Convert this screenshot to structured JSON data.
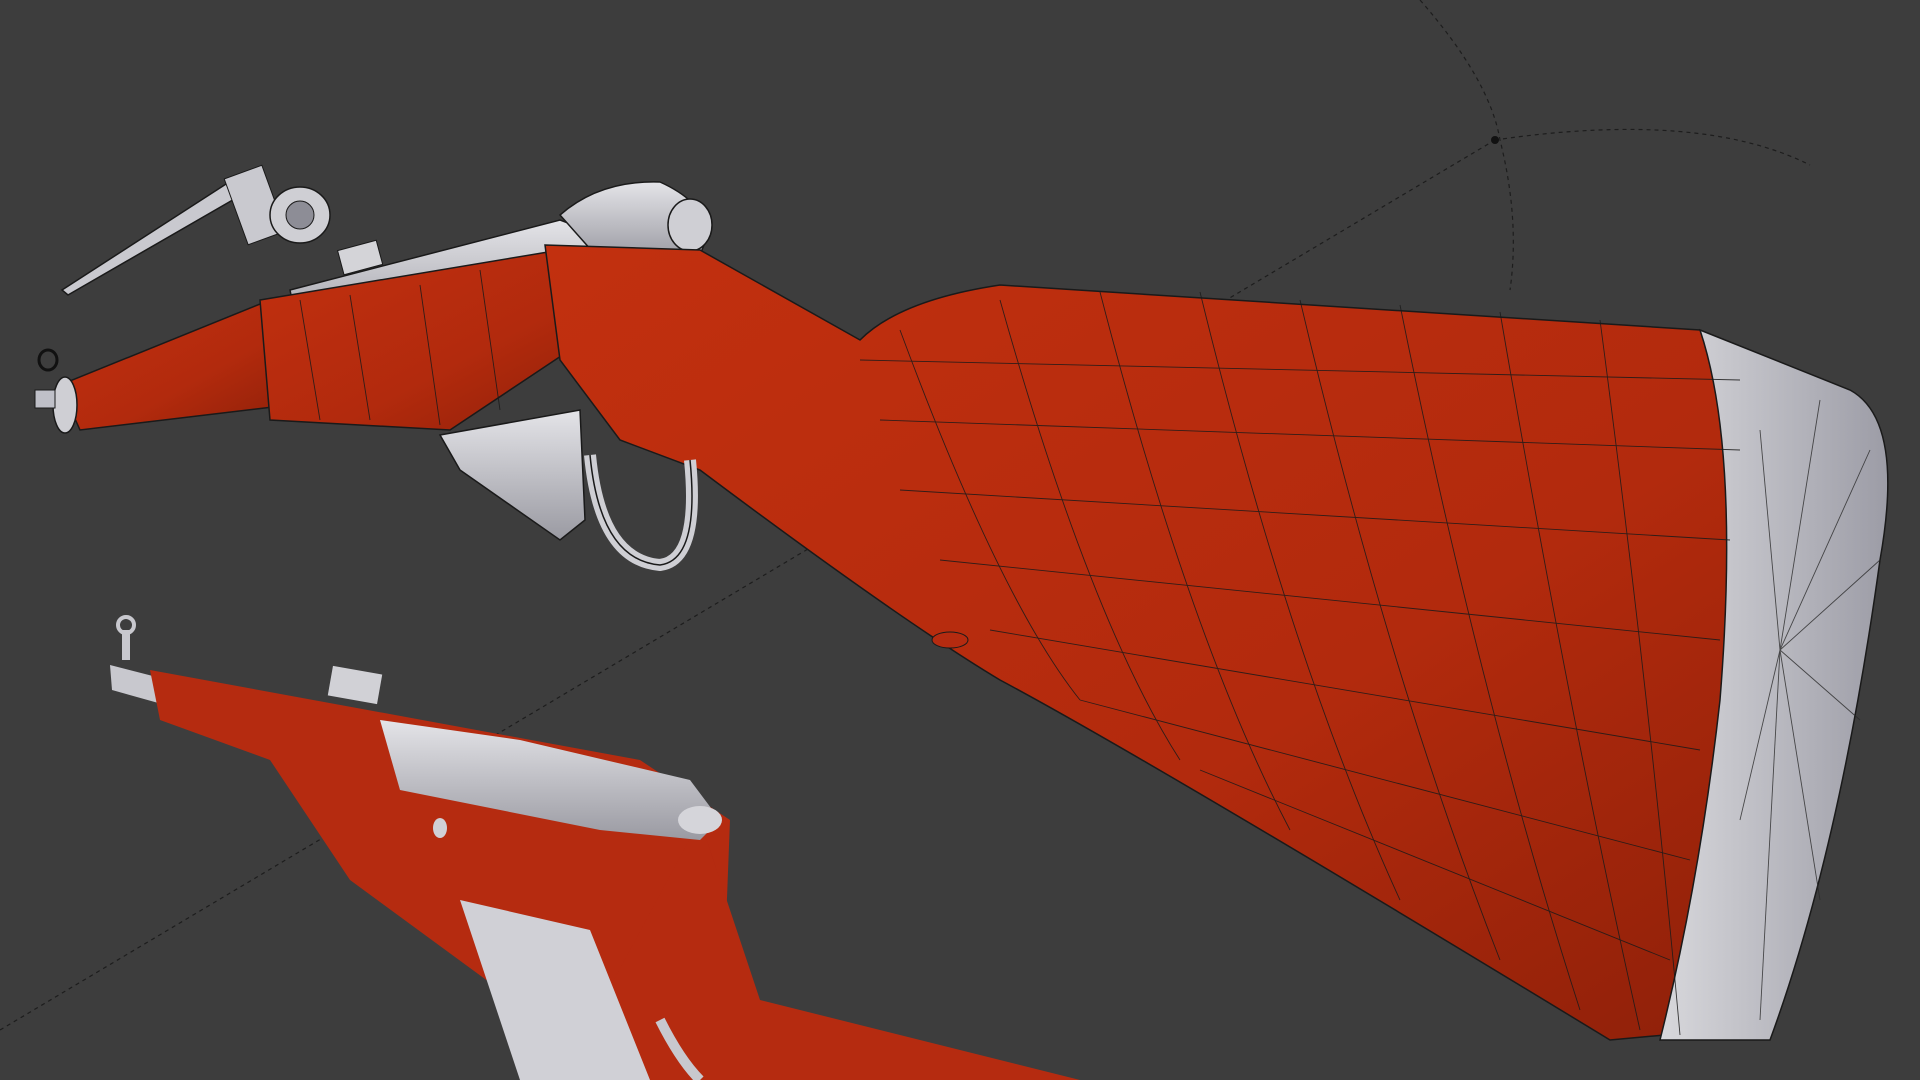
{
  "viewport": {
    "background": "#3d3d3d",
    "accent_colors": {
      "stock_red": "#b52b10",
      "stock_red_shadow": "#8e2009",
      "metal_grey": "#c9c9cf",
      "metal_dark": "#8d8d96",
      "wire": "#1a1a1a"
    },
    "objects": [
      {
        "name": "rifle-wireframe-model",
        "mode": "edit-wireframe-overlay"
      },
      {
        "name": "rifle-solid-preview",
        "mode": "solid-shaded"
      },
      {
        "name": "bayonet-wireframe",
        "mode": "edit-wireframe-overlay"
      }
    ],
    "gizmo": {
      "name": "rotation-pivot-indicator",
      "style": "dashed-arc"
    }
  }
}
